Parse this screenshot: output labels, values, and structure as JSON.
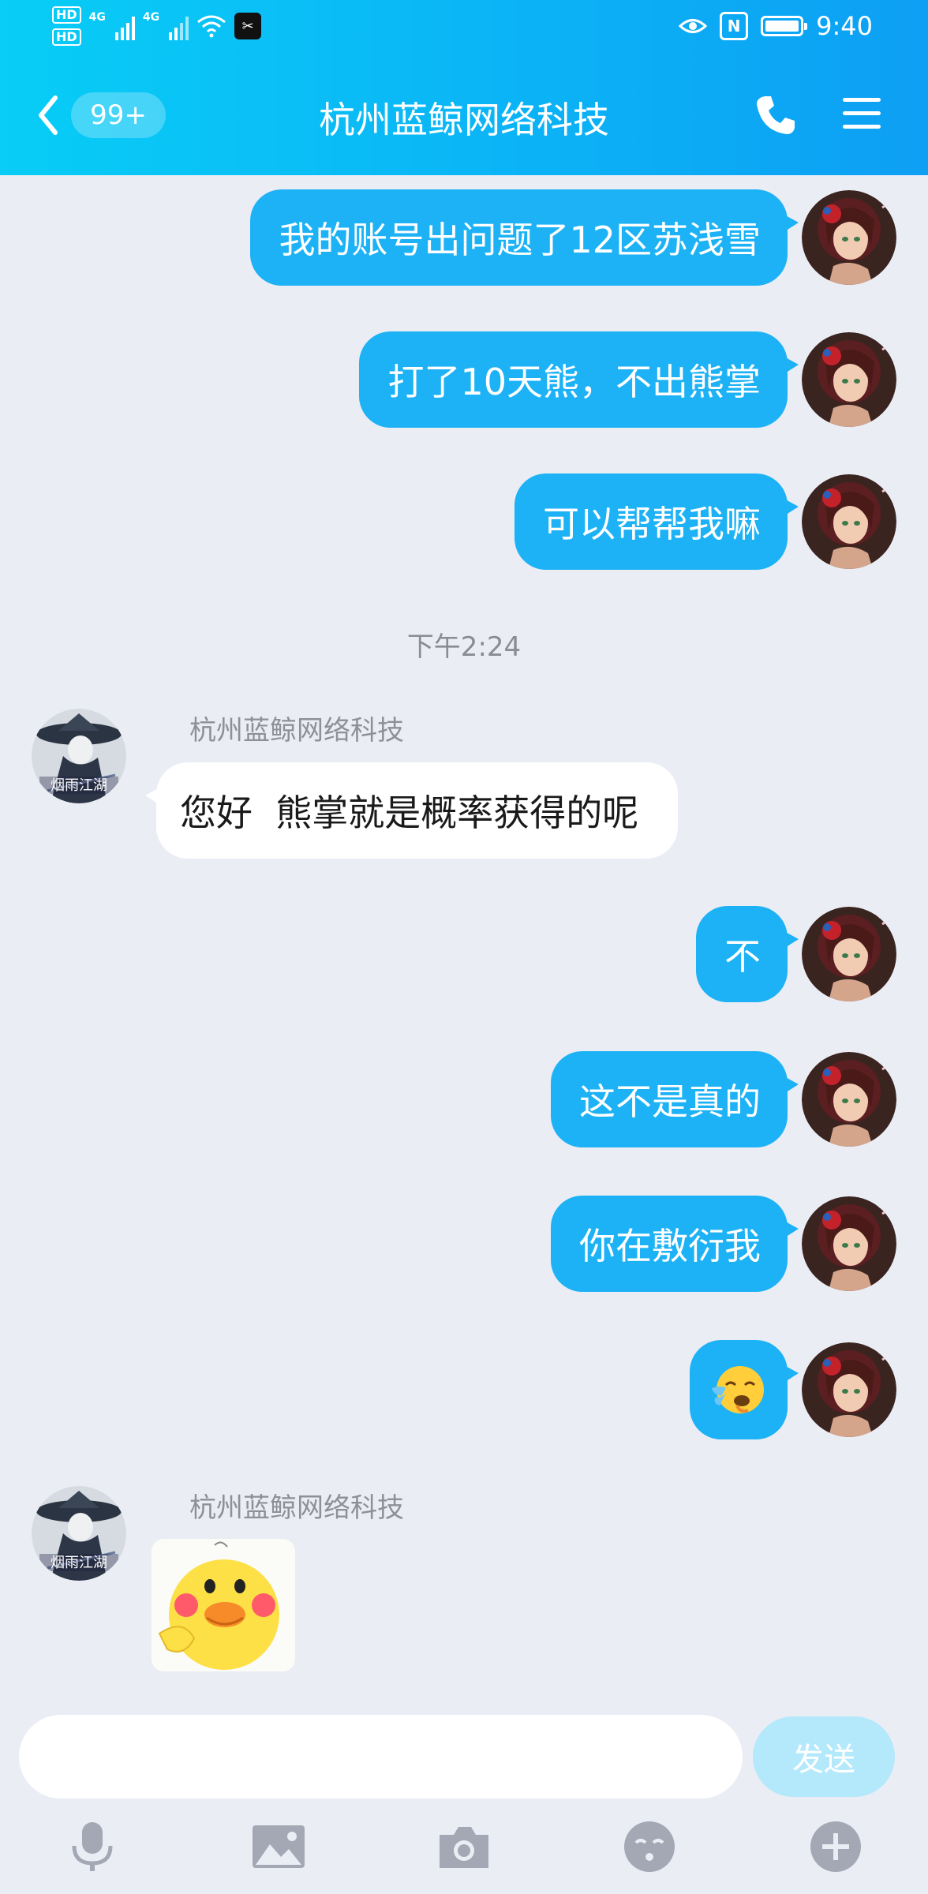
{
  "status_bar": {
    "hd1": "HD",
    "hd2": "HD",
    "sim1_net": "4G",
    "sim2_net": "4G",
    "time": "9:40",
    "nfc": "N",
    "icons": [
      "signal-icon",
      "wifi-icon",
      "capcut-app-icon",
      "eye-icon",
      "nfc-icon",
      "battery-icon"
    ]
  },
  "header": {
    "unread_count": "99+",
    "title": "杭州蓝鲸网络科技"
  },
  "messages": [
    {
      "from": "me",
      "text": "我的账号出问题了12区苏浅雪"
    },
    {
      "from": "me",
      "text": "打了10天熊，不出熊掌"
    },
    {
      "from": "me",
      "text": "可以帮帮我嘛"
    },
    {
      "time": "下午2:24"
    },
    {
      "from": "them",
      "sender": "杭州蓝鲸网络科技",
      "text": "您好  熊掌就是概率获得的呢"
    },
    {
      "from": "me",
      "text": "不"
    },
    {
      "from": "me",
      "text": "这不是真的"
    },
    {
      "from": "me",
      "text": "你在敷衍我"
    },
    {
      "from": "me",
      "emoji": "😢"
    },
    {
      "from": "them",
      "sender": "杭州蓝鲸网络科技",
      "sticker": "yellow-duck-sticker"
    }
  ],
  "input": {
    "value": "",
    "send_label": "发送"
  },
  "colors": {
    "header_gradient_start": "#08cdf6",
    "header_gradient_end": "#0d9ff3",
    "outgoing_bubble": "#1db2f5",
    "incoming_bubble": "#ffffff",
    "chat_background": "#ebedf5",
    "send_button_disabled": "#b3e9fb"
  }
}
